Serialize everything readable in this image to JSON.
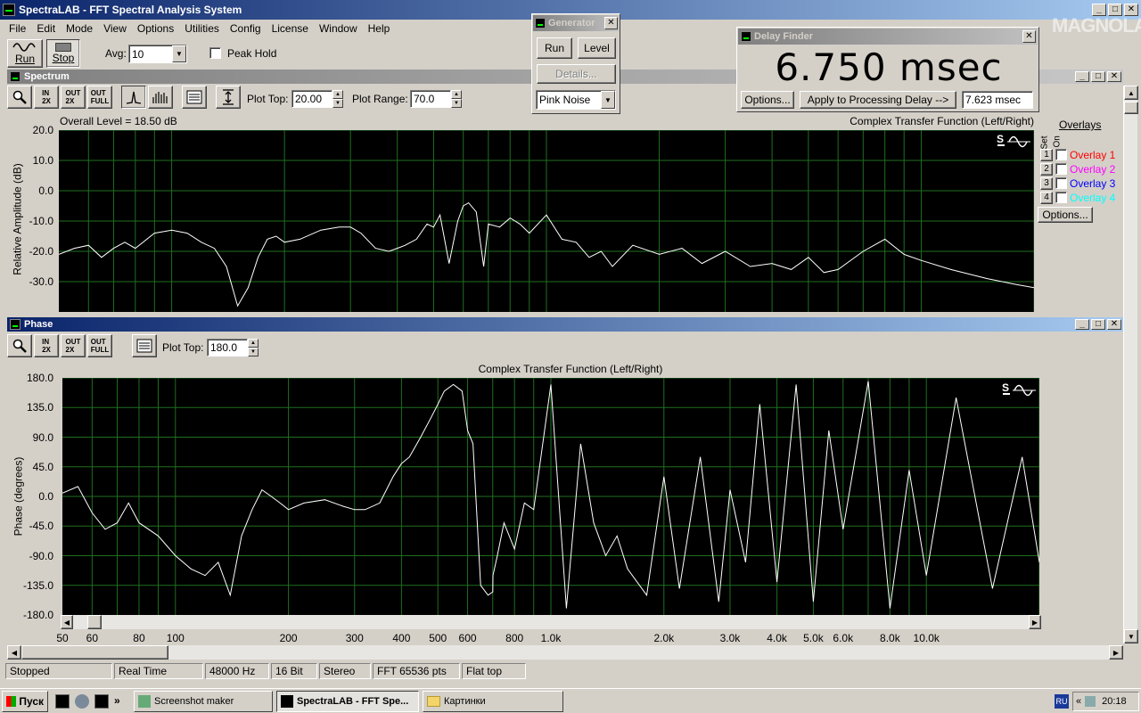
{
  "app": {
    "title": "SpectraLAB - FFT Spectral Analysis System",
    "menu": [
      "File",
      "Edit",
      "Mode",
      "View",
      "Options",
      "Utilities",
      "Config",
      "License",
      "Window",
      "Help"
    ]
  },
  "toolbar": {
    "run_label": "Run",
    "stop_label": "Stop",
    "avg_label": "Avg:",
    "avg_value": "10",
    "peak_hold_label": "Peak Hold"
  },
  "generator": {
    "title": "Generator",
    "run_label": "Run",
    "level_label": "Level",
    "details_label": "Details...",
    "signal": "Pink Noise"
  },
  "delay_finder": {
    "title": "Delay Finder",
    "value": "6.750 msec",
    "options_label": "Options...",
    "apply_label": "Apply to Processing Delay -->",
    "processing_delay": "7.623 msec"
  },
  "watermark": {
    "text": "MAGNOLA"
  },
  "spectrum": {
    "title": "Spectrum",
    "plot_top_label": "Plot Top:",
    "plot_top_value": "20.00",
    "plot_range_label": "Plot Range:",
    "plot_range_value": "70.0",
    "overall_level": "Overall Level = 18.50 dB",
    "plot_title": "Complex Transfer Function (Left/Right)",
    "ylabel": "Relative Amplitude (dB)",
    "yticks": [
      "20.0",
      "10.0",
      "0.0",
      "-10.0",
      "-20.0",
      "-30.0"
    ],
    "overlays_label": "Overlays",
    "set_label": "Set",
    "on_label": "On",
    "overlays": [
      {
        "num": "1",
        "name": "Overlay 1",
        "color": "#ff0000"
      },
      {
        "num": "2",
        "name": "Overlay 2",
        "color": "#ff00ff"
      },
      {
        "num": "3",
        "name": "Overlay 3",
        "color": "#0000ff"
      },
      {
        "num": "4",
        "name": "Overlay 4",
        "color": "#00ffff"
      }
    ],
    "options_label": "Options..."
  },
  "phase": {
    "title": "Phase",
    "plot_top_label": "Plot Top:",
    "plot_top_value": "180.0",
    "plot_title": "Complex Transfer Function (Left/Right)",
    "ylabel": "Phase (degrees)",
    "yticks": [
      "180.0",
      "135.0",
      "90.0",
      "45.0",
      "0.0",
      "-45.0",
      "-90.0",
      "-135.0",
      "-180.0"
    ],
    "xticks": [
      "50",
      "60",
      "80",
      "100",
      "200",
      "300",
      "400",
      "500",
      "600",
      "800",
      "1.0k",
      "2.0k",
      "3.0k",
      "4.0k",
      "5.0k",
      "6.0k",
      "8.0k",
      "10.0k"
    ]
  },
  "chart_data": [
    {
      "type": "line",
      "xscale": "log",
      "xlim": [
        50,
        20000
      ],
      "ylim": [
        -40,
        20
      ],
      "x": [
        50,
        55,
        60,
        65,
        70,
        75,
        80,
        90,
        100,
        110,
        120,
        130,
        140,
        150,
        160,
        170,
        180,
        190,
        200,
        220,
        250,
        280,
        300,
        320,
        350,
        380,
        400,
        420,
        450,
        480,
        500,
        520,
        550,
        580,
        600,
        620,
        650,
        680,
        700,
        750,
        800,
        850,
        900,
        1000,
        1100,
        1200,
        1300,
        1400,
        1500,
        1700,
        2000,
        2300,
        2600,
        3000,
        3500,
        4000,
        4500,
        5000,
        5500,
        6000,
        7000,
        8000,
        9000,
        10000,
        12000,
        15000,
        18000,
        20000
      ],
      "values": [
        -21,
        -19,
        -18,
        -22,
        -19,
        -17,
        -19,
        -14,
        -13,
        -14,
        -17,
        -19,
        -25,
        -38,
        -32,
        -22,
        -16,
        -15,
        -17,
        -16,
        -13,
        -12,
        -12,
        -14,
        -19,
        -20,
        -19,
        -18,
        -16,
        -11,
        -12,
        -8,
        -24,
        -10,
        -5,
        -4,
        -7,
        -25,
        -11,
        -12,
        -9,
        -11,
        -14,
        -8,
        -16,
        -17,
        -22,
        -20,
        -25,
        -18,
        -21,
        -19,
        -24,
        -20,
        -25,
        -24,
        -26,
        -22,
        -27,
        -26,
        -20,
        -16,
        -21,
        -23,
        -26,
        -29,
        -31,
        -32
      ]
    },
    {
      "type": "line",
      "xscale": "log",
      "xlim": [
        50,
        20000
      ],
      "ylim": [
        -180,
        180
      ],
      "x": [
        50,
        55,
        60,
        65,
        70,
        75,
        80,
        90,
        100,
        110,
        120,
        130,
        140,
        150,
        160,
        170,
        180,
        190,
        200,
        220,
        250,
        280,
        300,
        320,
        350,
        380,
        400,
        420,
        450,
        480,
        500,
        520,
        550,
        580,
        600,
        620,
        650,
        680,
        700,
        701,
        720,
        750,
        800,
        850,
        900,
        1000,
        1100,
        1200,
        1300,
        1400,
        1500,
        1600,
        1800,
        2000,
        2200,
        2500,
        2800,
        3000,
        3300,
        3600,
        4000,
        4500,
        5000,
        5500,
        6000,
        7000,
        8000,
        9000,
        10000,
        12000,
        15000,
        18000,
        20000
      ],
      "values": [
        5,
        15,
        -25,
        -50,
        -40,
        -10,
        -40,
        -60,
        -90,
        -110,
        -120,
        -100,
        -150,
        -60,
        -20,
        10,
        0,
        -10,
        -20,
        -10,
        -5,
        -15,
        -20,
        -20,
        -10,
        30,
        50,
        60,
        90,
        120,
        140,
        160,
        170,
        160,
        100,
        80,
        -135,
        -150,
        -145,
        -120,
        -90,
        -40,
        -80,
        -10,
        -20,
        170,
        -170,
        80,
        -40,
        -90,
        -60,
        -110,
        -150,
        30,
        -140,
        60,
        -160,
        10,
        -100,
        140,
        -130,
        170,
        -160,
        100,
        -50,
        175,
        -170,
        40,
        -120,
        150,
        -140,
        60,
        -100
      ]
    }
  ],
  "status": [
    "Stopped",
    "Real Time",
    "48000 Hz",
    "16 Bit",
    "Stereo",
    "FFT 65536 pts",
    "Flat top"
  ],
  "taskbar": {
    "start_label": "Пуск",
    "buttons": [
      "Screenshot maker",
      "SpectraLAB - FFT Spe...",
      "Картинки"
    ],
    "lang": "RU",
    "time": "20:18"
  }
}
